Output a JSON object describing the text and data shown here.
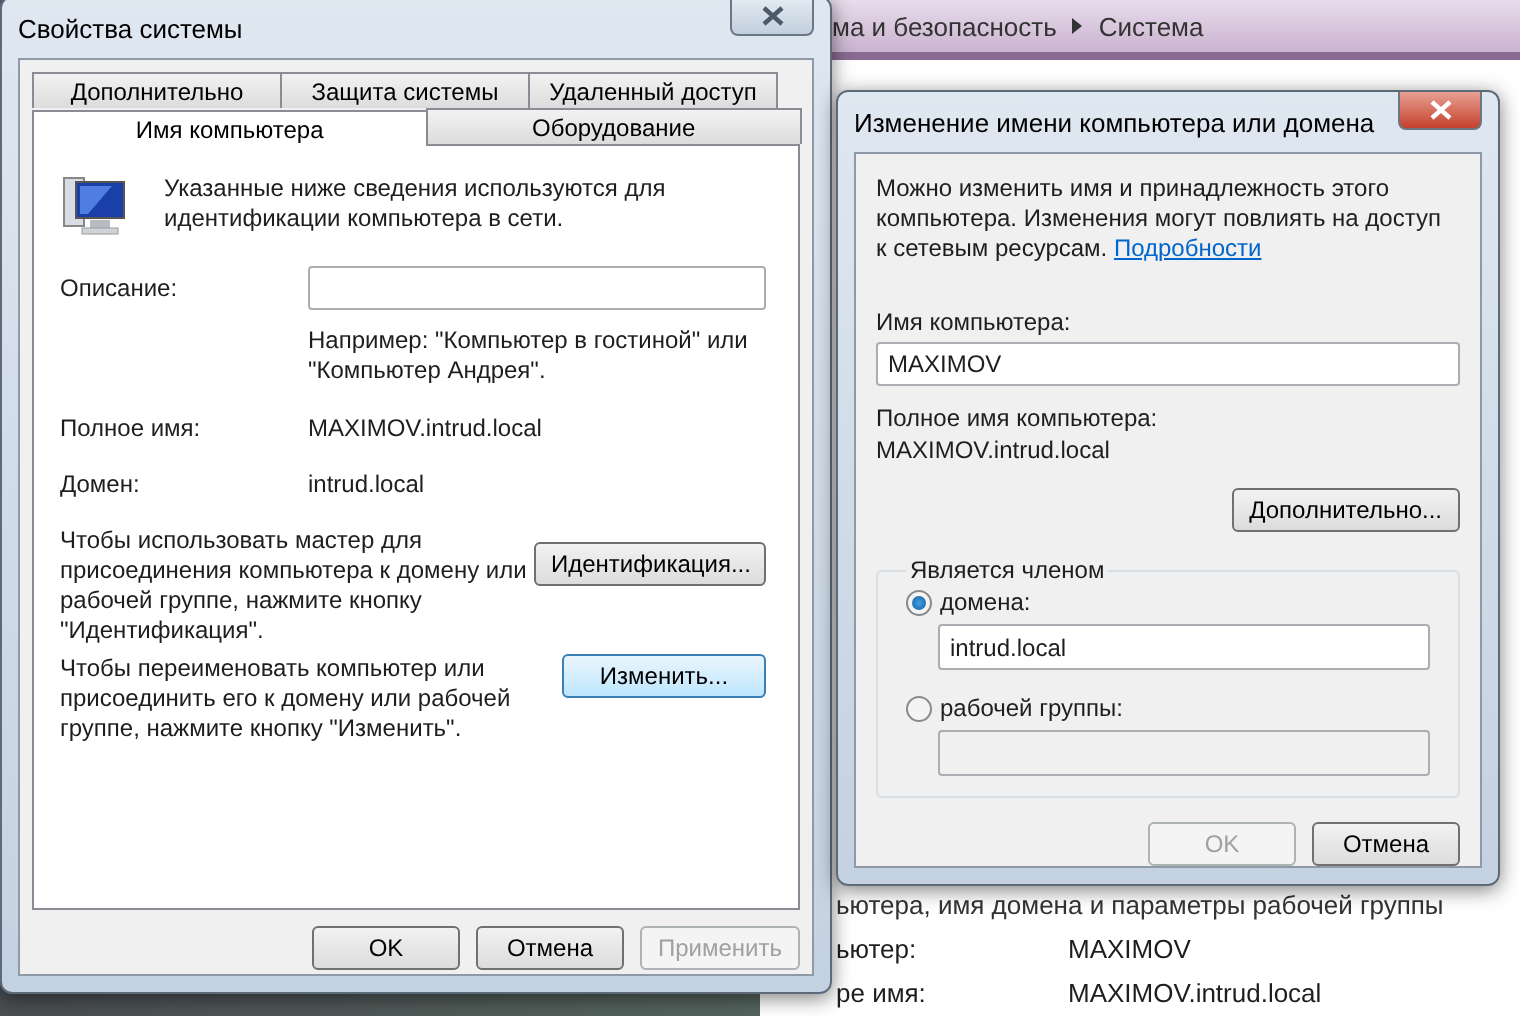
{
  "background_window": {
    "breadcrumb": [
      {
        "label": "ма и безопасность"
      },
      {
        "label": "Система"
      }
    ],
    "section_title": "ьютера, имя домена и параметры рабочей группы",
    "rows": [
      {
        "label": "ьютер:",
        "value": "MAXIMOV"
      },
      {
        "label": "ре имя:",
        "value": "MAXIMOV.intrud.local"
      }
    ]
  },
  "system_properties": {
    "title": "Свойства системы",
    "tab_rows": [
      {
        "tabs": [
          {
            "label": "Дополнительно",
            "selected": false
          },
          {
            "label": "Защита системы",
            "selected": false
          },
          {
            "label": "Удаленный доступ",
            "selected": false
          }
        ]
      },
      {
        "tabs": [
          {
            "label": "Имя компьютера",
            "selected": true
          },
          {
            "label": "Оборудование",
            "selected": false
          }
        ]
      }
    ],
    "intro": "Указанные ниже сведения используются для идентификации компьютера в сети.",
    "description_label": "Описание:",
    "description_hint": "Например: \"Компьютер в гостиной\" или \"Компьютер Андрея\".",
    "info": [
      {
        "label": "Полное имя:",
        "value": "MAXIMOV.intrud.local"
      },
      {
        "label": "Домен:",
        "value": "intrud.local"
      }
    ],
    "actions": [
      {
        "text": "Чтобы использовать мастер для присоединения компьютера к домену или рабочей группе, нажмите кнопку \"Идентификация\".",
        "button": "Идентификация...",
        "focused": false
      },
      {
        "text": "Чтобы переименовать компьютер или присоединить его к домену или рабочей группе, нажмите кнопку \"Изменить\".",
        "button": "Изменить...",
        "focused": true
      }
    ],
    "buttons": [
      {
        "label": "OK",
        "disabled": false
      },
      {
        "label": "Отмена",
        "disabled": false
      },
      {
        "label": "Применить",
        "disabled": true
      }
    ]
  },
  "rename_dialog": {
    "title": "Изменение имени компьютера или домена",
    "intro": "Можно изменить имя и принадлежность этого компьютера. Изменения могут повлиять на доступ к сетевым ресурсам.",
    "link": "Подробности",
    "computer_name_label": "Имя компьютера:",
    "computer_name_value": "MAXIMOV",
    "full_name_label": "Полное имя компьютера:",
    "full_name_value": "MAXIMOV.intrud.local",
    "more_button": "Дополнительно...",
    "member_of": {
      "legend": "Является членом",
      "options": [
        {
          "label": "домена:",
          "selected": true,
          "value": "intrud.local"
        },
        {
          "label": "рабочей группы:",
          "selected": false
        }
      ]
    },
    "buttons": [
      {
        "label": "OK",
        "disabled": true
      },
      {
        "label": "Отмена",
        "disabled": false
      }
    ]
  }
}
